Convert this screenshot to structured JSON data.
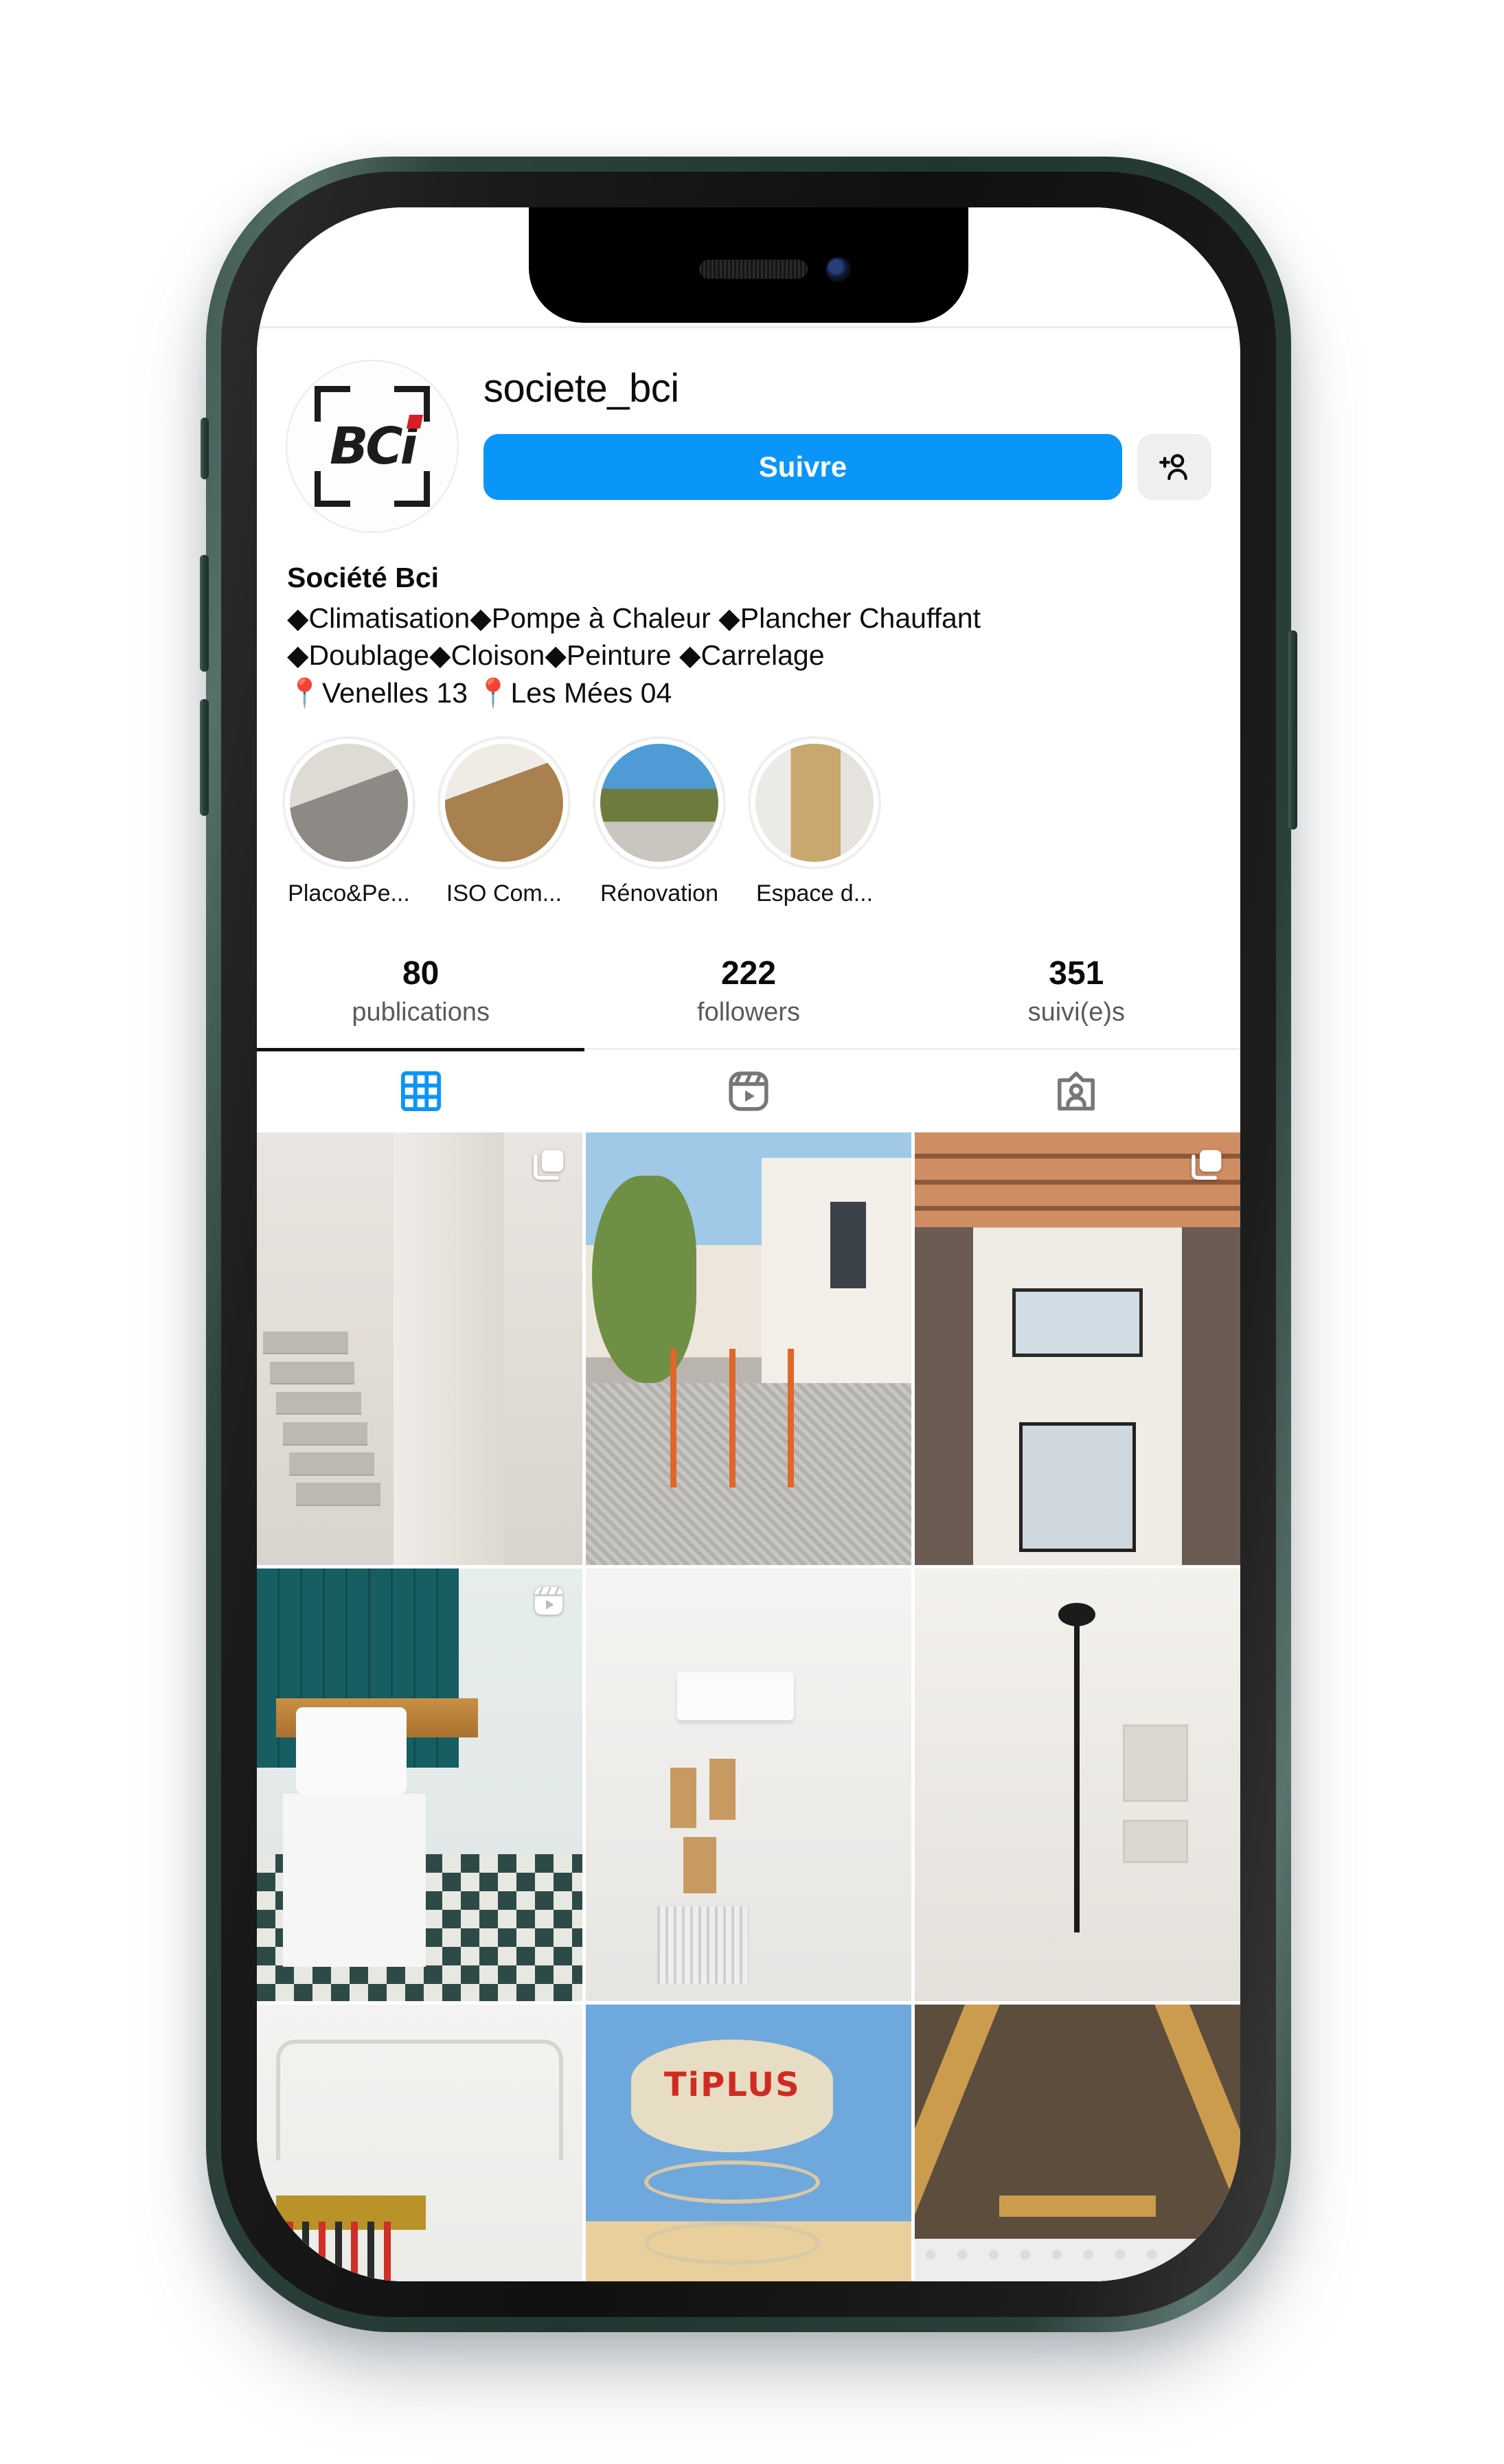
{
  "profile": {
    "username": "societe_bci",
    "avatar_logo_text": "BCi",
    "avatar_icon": "bci-logo-scan-frame",
    "follow_button_label": "Suivre",
    "add_person_icon": "add-person-icon",
    "bio_name": "Société Bci",
    "bio_lines": [
      "◆Climatisation◆Pompe à Chaleur ◆Plancher Chauffant ◆Doublage◆Cloison◆Peinture ◆Carrelage",
      "📍Venelles 13 📍Les Mées 04"
    ],
    "bio_services": [
      "Climatisation",
      "Pompe à Chaleur",
      "Plancher Chauffant",
      "Doublage",
      "Cloison",
      "Peinture",
      "Carrelage"
    ],
    "bio_locations": [
      "Venelles 13",
      "Les Mées 04"
    ]
  },
  "highlights": [
    {
      "label": "Placo&Pe...",
      "art": "highlight-placo"
    },
    {
      "label": "ISO Com...",
      "art": "highlight-iso"
    },
    {
      "label": "Rénovation",
      "art": "highlight-renovation"
    },
    {
      "label": "Espace d...",
      "art": "highlight-espace"
    }
  ],
  "stats": [
    {
      "value": "80",
      "label": "publications"
    },
    {
      "value": "222",
      "label": "followers"
    },
    {
      "value": "351",
      "label": "suivi(e)s"
    }
  ],
  "tabs": [
    {
      "icon": "grid-icon",
      "active": true
    },
    {
      "icon": "reels-icon",
      "active": false
    },
    {
      "icon": "tagged-person-icon",
      "active": false
    }
  ],
  "posts": [
    {
      "description": "concrete-staircase-construction",
      "badge": "carousel-icon",
      "art": "art-stairs"
    },
    {
      "description": "outdoor-trench-groundwork",
      "badge": "",
      "art": "art-outdoor"
    },
    {
      "description": "interior-ceiling-ductwork",
      "badge": "carousel-icon",
      "art": "art-ceiling"
    },
    {
      "description": "bathroom-vanity-green-tiles",
      "badge": "reels-icon",
      "art": "art-bath"
    },
    {
      "description": "room-with-air-conditioner",
      "badge": "",
      "art": "art-ac"
    },
    {
      "description": "white-tiled-shower",
      "badge": "",
      "art": "art-shower"
    },
    {
      "description": "underfloor-heating-manifold",
      "badge": "",
      "art": "art-plumb"
    },
    {
      "description": "tiplus-building-sign",
      "badge": "",
      "art": "art-sign"
    },
    {
      "description": "attic-insulation-rafters",
      "badge": "",
      "art": "art-attic"
    }
  ],
  "colors": {
    "accent_blue": "#0a95f8",
    "diamond_blue": "#1877d4",
    "pin_red": "#e23b2e",
    "logo_red": "#d81f26",
    "active_tab": "#0a95f8",
    "phone_frame": "#2e433d",
    "text_primary": "#0b0b0b",
    "text_secondary": "#5a5a5a"
  }
}
